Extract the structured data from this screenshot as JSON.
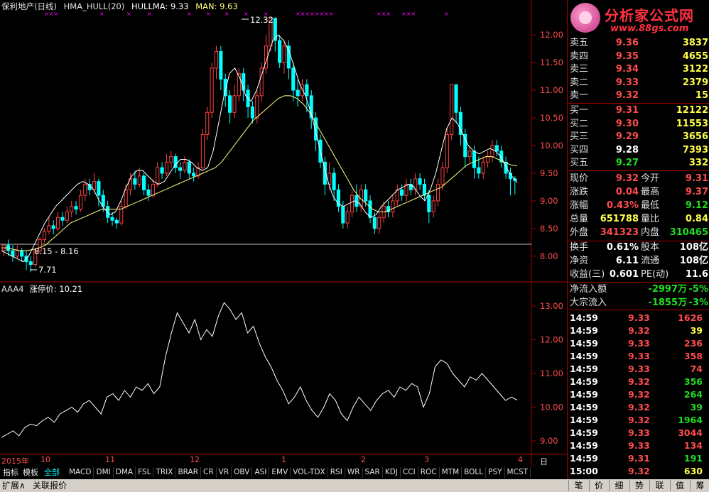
{
  "main_chart": {
    "stock": "保利地产(日线)",
    "indicator": "HMA_HULL(20)",
    "hullma": "HULLMA: 9.33",
    "man": "MAN: 9.63",
    "high_label": "12.32",
    "low_label": "7.71",
    "range_label": "8.15 - 8.16",
    "y_ticks": [
      "12.00",
      "11.50",
      "11.00",
      "10.50",
      "10.00",
      "9.50",
      "9.00",
      "8.50",
      "8.00"
    ],
    "colors": {
      "up": "#ff4040",
      "down": "#00ffff",
      "hull": "#ffffff",
      "man": "#ffff80",
      "marker": "#ff00ff"
    },
    "signal_markers": "×××"
  },
  "sub_chart": {
    "name": "AAA4",
    "label": "涨停价: 10.21",
    "y_ticks": [
      "13.00",
      "12.00",
      "11.00",
      "10.00",
      "9.00"
    ]
  },
  "x_axis": {
    "labels": [
      "2015年",
      "10",
      "11",
      "12",
      "1",
      "2",
      "3",
      "4"
    ],
    "period": "日线",
    "controls": [
      "+",
      "-",
      "↑",
      "↓"
    ]
  },
  "chart_data": {
    "type": "candlestick",
    "title": "保利地产(日线)",
    "ylim_main": [
      7.6,
      12.4
    ],
    "ylim_sub": [
      8.6,
      13.4
    ],
    "candles": [
      [
        8.1,
        8.2,
        8.2,
        8.0
      ],
      [
        8.2,
        8.1,
        8.3,
        8.0
      ],
      [
        8.1,
        8.0,
        8.2,
        7.9
      ],
      [
        8.0,
        8.1,
        8.2,
        7.95
      ],
      [
        8.1,
        8.0,
        8.15,
        7.9
      ],
      [
        8.0,
        7.9,
        8.1,
        7.75
      ],
      [
        7.9,
        7.85,
        8.0,
        7.71
      ],
      [
        7.85,
        8.1,
        8.15,
        7.8
      ],
      [
        8.1,
        8.3,
        8.35,
        8.05
      ],
      [
        8.3,
        8.45,
        8.5,
        8.25
      ],
      [
        8.45,
        8.55,
        8.7,
        8.4
      ],
      [
        8.55,
        8.5,
        8.65,
        8.4
      ],
      [
        8.5,
        8.7,
        8.8,
        8.45
      ],
      [
        8.7,
        8.65,
        8.8,
        8.55
      ],
      [
        8.65,
        8.8,
        8.9,
        8.6
      ],
      [
        8.8,
        8.9,
        9.0,
        8.7
      ],
      [
        8.9,
        8.85,
        9.0,
        8.75
      ],
      [
        8.85,
        9.1,
        9.2,
        8.8
      ],
      [
        9.1,
        9.3,
        9.4,
        9.0
      ],
      [
        9.3,
        9.2,
        9.4,
        9.1
      ],
      [
        9.2,
        9.35,
        9.5,
        9.15
      ],
      [
        9.35,
        9.1,
        9.4,
        8.9
      ],
      [
        9.1,
        8.9,
        9.2,
        8.8
      ],
      [
        8.9,
        8.7,
        9.0,
        8.6
      ],
      [
        8.7,
        8.65,
        8.8,
        8.55
      ],
      [
        8.65,
        8.6,
        8.7,
        8.5
      ],
      [
        8.6,
        8.9,
        9.0,
        8.55
      ],
      [
        8.9,
        9.2,
        9.3,
        8.85
      ],
      [
        9.2,
        9.4,
        9.5,
        9.1
      ],
      [
        9.4,
        9.3,
        9.55,
        9.2
      ],
      [
        9.3,
        9.45,
        9.6,
        9.25
      ],
      [
        9.45,
        9.2,
        9.5,
        9.1
      ],
      [
        9.2,
        9.1,
        9.3,
        9.0
      ],
      [
        9.1,
        9.3,
        9.4,
        9.05
      ],
      [
        9.3,
        9.6,
        9.7,
        9.25
      ],
      [
        9.6,
        9.5,
        9.7,
        9.4
      ],
      [
        9.5,
        9.7,
        9.85,
        9.45
      ],
      [
        9.7,
        9.8,
        9.9,
        9.6
      ],
      [
        9.8,
        9.6,
        9.85,
        9.5
      ],
      [
        9.6,
        9.55,
        9.7,
        9.4
      ],
      [
        9.55,
        9.7,
        9.8,
        9.5
      ],
      [
        9.7,
        9.5,
        9.75,
        9.4
      ],
      [
        9.5,
        9.45,
        9.6,
        9.35
      ],
      [
        9.45,
        9.6,
        9.7,
        9.4
      ],
      [
        9.6,
        10.2,
        10.3,
        9.55
      ],
      [
        10.2,
        10.6,
        10.7,
        10.1
      ],
      [
        10.6,
        11.4,
        11.5,
        10.5
      ],
      [
        11.4,
        11.7,
        11.8,
        11.2
      ],
      [
        11.7,
        11.2,
        11.8,
        11.0
      ],
      [
        11.2,
        10.9,
        11.3,
        10.7
      ],
      [
        10.9,
        10.6,
        11.0,
        10.4
      ],
      [
        10.6,
        10.9,
        11.1,
        10.5
      ],
      [
        10.9,
        11.3,
        11.4,
        10.8
      ],
      [
        11.3,
        11.0,
        11.4,
        10.8
      ],
      [
        11.0,
        10.7,
        11.1,
        10.5
      ],
      [
        10.7,
        10.5,
        10.8,
        10.4
      ],
      [
        10.5,
        10.9,
        11.0,
        10.4
      ],
      [
        10.9,
        11.4,
        11.5,
        10.8
      ],
      [
        11.4,
        11.8,
        12.0,
        11.3
      ],
      [
        11.8,
        12.3,
        12.32,
        11.7
      ],
      [
        12.3,
        11.9,
        12.32,
        11.7
      ],
      [
        11.9,
        11.5,
        12.0,
        11.4
      ],
      [
        11.5,
        11.8,
        11.9,
        11.3
      ],
      [
        11.8,
        11.4,
        11.9,
        11.2
      ],
      [
        11.4,
        11.0,
        11.5,
        10.8
      ],
      [
        11.0,
        10.9,
        11.2,
        10.7
      ],
      [
        10.9,
        11.1,
        11.2,
        10.8
      ],
      [
        11.1,
        10.9,
        11.2,
        10.6
      ],
      [
        10.9,
        10.5,
        11.0,
        10.3
      ],
      [
        10.5,
        10.1,
        10.6,
        9.9
      ],
      [
        10.1,
        9.7,
        10.2,
        9.6
      ],
      [
        9.7,
        9.3,
        9.8,
        9.1
      ],
      [
        9.3,
        9.5,
        9.7,
        9.2
      ],
      [
        9.5,
        9.2,
        9.6,
        9.0
      ],
      [
        9.2,
        8.9,
        9.3,
        8.8
      ],
      [
        8.9,
        8.6,
        9.0,
        8.5
      ],
      [
        8.6,
        8.8,
        8.9,
        8.5
      ],
      [
        8.8,
        9.1,
        9.2,
        8.7
      ],
      [
        9.1,
        8.9,
        9.3,
        8.8
      ],
      [
        8.9,
        9.2,
        9.3,
        8.8
      ],
      [
        9.2,
        9.0,
        9.3,
        8.9
      ],
      [
        9.0,
        8.7,
        9.1,
        8.6
      ],
      [
        8.7,
        8.5,
        8.8,
        8.4
      ],
      [
        8.5,
        8.7,
        8.8,
        8.4
      ],
      [
        8.7,
        8.9,
        9.0,
        8.6
      ],
      [
        8.9,
        8.8,
        9.0,
        8.7
      ],
      [
        8.8,
        9.0,
        9.1,
        8.7
      ],
      [
        9.0,
        9.2,
        9.3,
        8.9
      ],
      [
        9.2,
        9.1,
        9.3,
        9.0
      ],
      [
        9.1,
        9.3,
        9.4,
        9.0
      ],
      [
        9.3,
        9.2,
        9.4,
        9.1
      ],
      [
        9.2,
        9.4,
        9.5,
        9.1
      ],
      [
        9.4,
        9.3,
        9.5,
        9.2
      ],
      [
        9.3,
        9.1,
        9.4,
        9.0
      ],
      [
        9.1,
        8.8,
        9.2,
        8.6
      ],
      [
        8.8,
        9.0,
        9.1,
        8.7
      ],
      [
        9.0,
        9.3,
        9.4,
        8.9
      ],
      [
        9.3,
        9.6,
        9.7,
        9.2
      ],
      [
        9.6,
        10.2,
        10.3,
        9.5
      ],
      [
        10.2,
        11.1,
        11.1,
        10.1
      ],
      [
        11.1,
        10.6,
        11.1,
        10.4
      ],
      [
        10.6,
        10.2,
        10.7,
        10.0
      ],
      [
        10.2,
        9.8,
        10.3,
        9.6
      ],
      [
        9.8,
        9.9,
        10.0,
        9.7
      ],
      [
        9.9,
        9.6,
        10.0,
        9.4
      ],
      [
        9.6,
        9.5,
        9.8,
        9.4
      ],
      [
        9.5,
        9.7,
        9.8,
        9.4
      ],
      [
        9.7,
        9.8,
        9.9,
        9.6
      ],
      [
        9.8,
        10.0,
        10.1,
        9.7
      ],
      [
        10.0,
        9.9,
        10.1,
        9.8
      ],
      [
        9.9,
        9.7,
        10.0,
        9.6
      ],
      [
        9.7,
        9.5,
        9.8,
        9.4
      ],
      [
        9.5,
        9.4,
        9.6,
        9.1
      ],
      [
        9.4,
        9.37,
        9.45,
        9.12
      ]
    ],
    "sub_values": [
      9.1,
      9.2,
      9.3,
      9.15,
      9.4,
      9.5,
      9.45,
      9.6,
      9.7,
      9.55,
      9.8,
      9.9,
      10.0,
      9.85,
      10.1,
      10.2,
      10.0,
      9.8,
      10.3,
      10.4,
      10.2,
      10.5,
      10.3,
      10.6,
      10.5,
      10.7,
      10.4,
      10.6,
      11.5,
      12.2,
      12.8,
      12.5,
      12.2,
      12.6,
      12.0,
      12.3,
      12.1,
      12.7,
      13.1,
      12.9,
      12.6,
      12.8,
      12.2,
      12.4,
      11.9,
      11.5,
      11.2,
      10.8,
      10.5,
      10.1,
      10.3,
      10.6,
      10.2,
      9.9,
      9.7,
      10.0,
      10.4,
      10.2,
      9.8,
      9.6,
      10.0,
      10.3,
      10.1,
      9.9,
      10.2,
      10.4,
      10.5,
      10.3,
      10.6,
      10.5,
      10.7,
      10.6,
      10.0,
      10.4,
      11.2,
      11.4,
      11.3,
      11.0,
      10.8,
      10.6,
      10.9,
      10.8,
      11.0,
      10.8,
      10.6,
      10.4,
      10.2,
      10.3,
      10.21
    ],
    "hull": [
      8.1,
      8.05,
      8.0,
      7.95,
      7.9,
      8.0,
      8.2,
      8.4,
      8.6,
      8.75,
      8.9,
      9.0,
      9.1,
      9.2,
      9.3,
      9.35,
      9.3,
      9.2,
      9.0,
      8.85,
      8.75,
      8.8,
      9.0,
      9.25,
      9.45,
      9.55,
      9.55,
      9.45,
      9.35,
      9.3,
      9.35,
      9.5,
      9.65,
      9.75,
      9.75,
      9.7,
      9.6,
      9.55,
      9.6,
      9.9,
      10.4,
      10.9,
      11.3,
      11.4,
      11.2,
      10.9,
      10.8,
      11.0,
      11.3,
      11.6,
      11.9,
      12.0,
      11.9,
      11.7,
      11.4,
      11.1,
      10.9,
      10.6,
      10.2,
      9.8,
      9.4,
      9.1,
      8.95,
      8.9,
      8.95,
      9.0,
      8.95,
      8.8,
      8.7,
      8.75,
      8.9,
      9.0,
      9.1,
      9.2,
      9.25,
      9.3,
      9.25,
      9.1,
      9.0,
      9.2,
      9.5,
      9.9,
      10.3,
      10.5,
      10.4,
      10.2,
      10.0,
      9.9,
      9.85,
      9.9,
      9.95,
      9.9,
      9.8,
      9.6,
      9.45,
      9.33
    ],
    "man": [
      8.15,
      8.15,
      8.12,
      8.1,
      8.1,
      8.12,
      8.15,
      8.2,
      8.3,
      8.4,
      8.5,
      8.6,
      8.65,
      8.7,
      8.75,
      8.8,
      8.85,
      8.85,
      8.85,
      8.85,
      8.9,
      8.95,
      9.0,
      9.05,
      9.1,
      9.15,
      9.2,
      9.25,
      9.3,
      9.35,
      9.4,
      9.45,
      9.5,
      9.55,
      9.6,
      9.7,
      9.85,
      10.0,
      10.15,
      10.3,
      10.45,
      10.55,
      10.65,
      10.75,
      10.85,
      10.9,
      10.9,
      10.85,
      10.75,
      10.6,
      10.4,
      10.2,
      10.0,
      9.8,
      9.6,
      9.4,
      9.2,
      9.05,
      8.95,
      8.85,
      8.8,
      8.8,
      8.85,
      8.9,
      8.95,
      9.0,
      9.05,
      9.1,
      9.15,
      9.2,
      9.25,
      9.35,
      9.45,
      9.55,
      9.65,
      9.7,
      9.75,
      9.8,
      9.8,
      9.75,
      9.7,
      9.65,
      9.63
    ]
  },
  "quote": {
    "logo_title": "分析家公式网",
    "logo_url": "www.88gs.com",
    "asks": [
      {
        "label": "卖五",
        "price": "9.36",
        "vol": "3837"
      },
      {
        "label": "卖四",
        "price": "9.35",
        "vol": "4655"
      },
      {
        "label": "卖三",
        "price": "9.34",
        "vol": "3122"
      },
      {
        "label": "卖二",
        "price": "9.33",
        "vol": "2379"
      },
      {
        "label": "卖一",
        "price": "9.32",
        "vol": "15"
      }
    ],
    "bids": [
      {
        "label": "买一",
        "price": "9.31",
        "vol": "12122",
        "color": "red"
      },
      {
        "label": "买二",
        "price": "9.30",
        "vol": "11553",
        "color": "red"
      },
      {
        "label": "买三",
        "price": "9.29",
        "vol": "3656",
        "color": "red"
      },
      {
        "label": "买四",
        "price": "9.28",
        "vol": "7393",
        "color": "white"
      },
      {
        "label": "买五",
        "price": "9.27",
        "vol": "332",
        "color": "green"
      }
    ],
    "stats": [
      {
        "l1": "现价",
        "v1": "9.32",
        "c1": "red",
        "l2": "今开",
        "v2": "9.31",
        "c2": "red"
      },
      {
        "l1": "涨跌",
        "v1": "0.04",
        "c1": "red",
        "l2": "最高",
        "v2": "9.37",
        "c2": "red"
      },
      {
        "l1": "涨幅",
        "v1": "0.43%",
        "c1": "red",
        "l2": "最低",
        "v2": "9.12",
        "c2": "green"
      },
      {
        "l1": "总量",
        "v1": "651788",
        "c1": "yellow",
        "l2": "量比",
        "v2": "0.84",
        "c2": "yellow"
      },
      {
        "l1": "外盘",
        "v1": "341323",
        "c1": "red",
        "l2": "内盘",
        "v2": "310465",
        "c2": "green"
      }
    ],
    "fin": [
      {
        "l1": "换手",
        "v1": "0.61%",
        "l2": "股本",
        "v2": "108亿"
      },
      {
        "l1": "净资",
        "v1": "6.11",
        "l2": "流通",
        "v2": "108亿"
      },
      {
        "l1": "收益(三)",
        "v1": "0.601",
        "l2": "PE(动)",
        "v2": "11.6"
      }
    ],
    "flows": [
      {
        "label": "净流入额",
        "amount": "-2997万",
        "pct": "-5%"
      },
      {
        "label": "大宗流入",
        "amount": "-1855万",
        "pct": "-3%"
      }
    ],
    "trades": [
      {
        "time": "14:59",
        "price": "9.33",
        "vol": "1626",
        "pc": "red",
        "vc": "red"
      },
      {
        "time": "14:59",
        "price": "9.32",
        "vol": "39",
        "pc": "red",
        "vc": "yellow"
      },
      {
        "time": "14:59",
        "price": "9.33",
        "vol": "236",
        "pc": "red",
        "vc": "red"
      },
      {
        "time": "14:59",
        "price": "9.33",
        "vol": "358",
        "pc": "red",
        "vc": "red"
      },
      {
        "time": "14:59",
        "price": "9.33",
        "vol": "74",
        "pc": "red",
        "vc": "red"
      },
      {
        "time": "14:59",
        "price": "9.32",
        "vol": "356",
        "pc": "red",
        "vc": "green"
      },
      {
        "time": "14:59",
        "price": "9.32",
        "vol": "264",
        "pc": "red",
        "vc": "green"
      },
      {
        "time": "14:59",
        "price": "9.32",
        "vol": "39",
        "pc": "red",
        "vc": "green"
      },
      {
        "time": "14:59",
        "price": "9.32",
        "vol": "1964",
        "pc": "red",
        "vc": "green"
      },
      {
        "time": "14:59",
        "price": "9.33",
        "vol": "3044",
        "pc": "red",
        "vc": "red"
      },
      {
        "time": "14:59",
        "price": "9.33",
        "vol": "134",
        "pc": "red",
        "vc": "red"
      },
      {
        "time": "14:59",
        "price": "9.31",
        "vol": "191",
        "pc": "red",
        "vc": "green"
      },
      {
        "time": "15:00",
        "price": "9.32",
        "vol": "630",
        "pc": "red",
        "vc": "yellow"
      }
    ]
  },
  "tabs": {
    "left": [
      "指标",
      "模板",
      "全部"
    ],
    "items": [
      "MACD",
      "DMI",
      "DMA",
      "FSL",
      "TRIX",
      "BRAR",
      "CR",
      "VR",
      "OBV",
      "ASI",
      "EMV",
      "VOL-TDX",
      "RSI",
      "WR",
      "SAR",
      "KDJ",
      "CCI",
      "ROC",
      "MTM",
      "BOLL",
      "PSY",
      "MCST"
    ]
  },
  "status": {
    "expand": "扩展∧",
    "related": "关联报价",
    "right_tabs": [
      "笔",
      "价",
      "细",
      "势",
      "联",
      "值",
      "筹"
    ]
  }
}
